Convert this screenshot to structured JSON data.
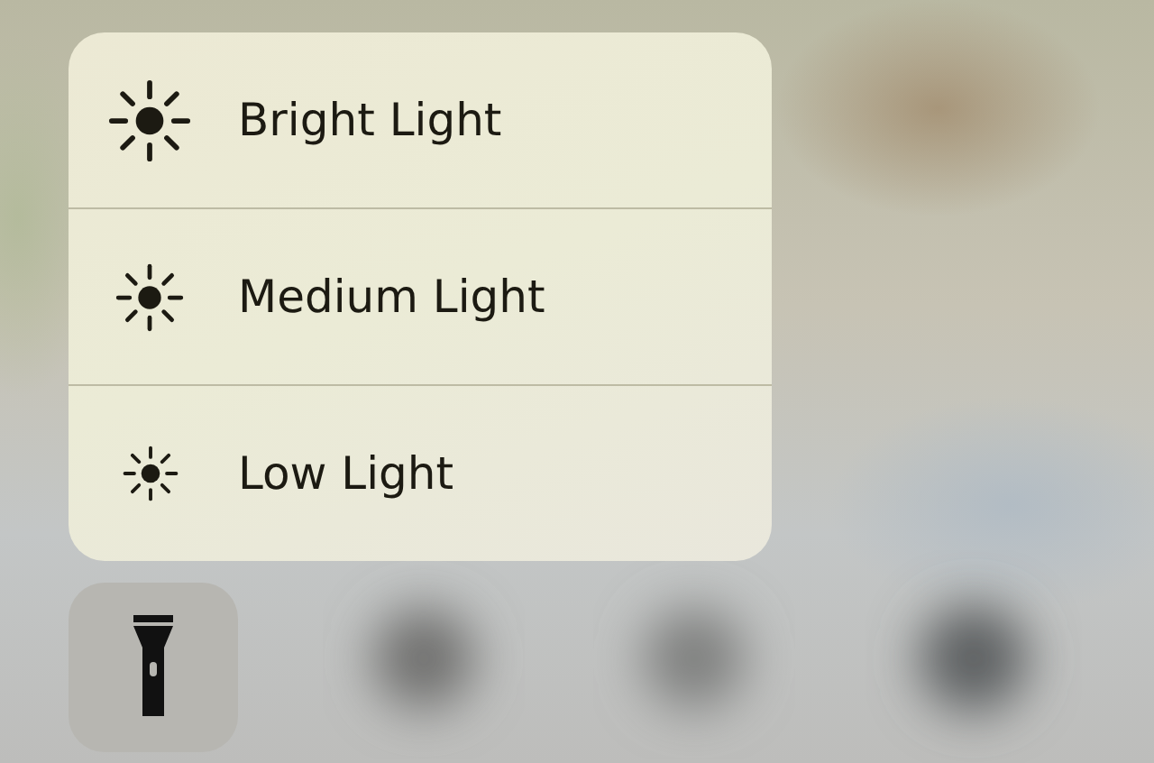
{
  "menu": {
    "items": [
      {
        "label": "Bright Light",
        "kind": "bright"
      },
      {
        "label": "Medium Light",
        "kind": "medium"
      },
      {
        "label": "Low Light",
        "kind": "low"
      }
    ]
  },
  "flashlight_button": {
    "on": false
  }
}
